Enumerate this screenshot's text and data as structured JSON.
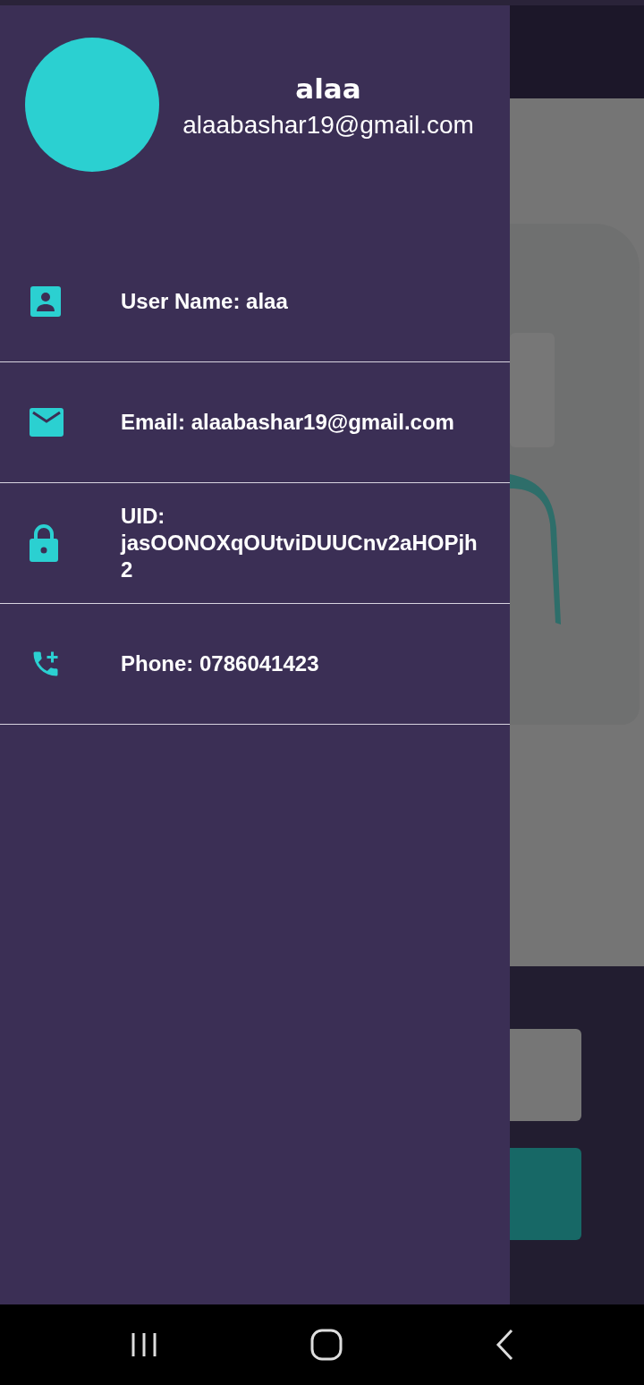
{
  "drawer": {
    "header": {
      "name": "alaa",
      "email": "alaabashar19@gmail.com"
    },
    "items": [
      {
        "kind": "user",
        "text": "User Name: alaa"
      },
      {
        "kind": "email",
        "text": "Email: alaabashar19@gmail.com"
      },
      {
        "kind": "lock",
        "text": "UID: jasOONOXqOUtviDUUCnv2aHOPjh2"
      },
      {
        "kind": "phone",
        "text": "Phone: 0786041423"
      }
    ]
  }
}
